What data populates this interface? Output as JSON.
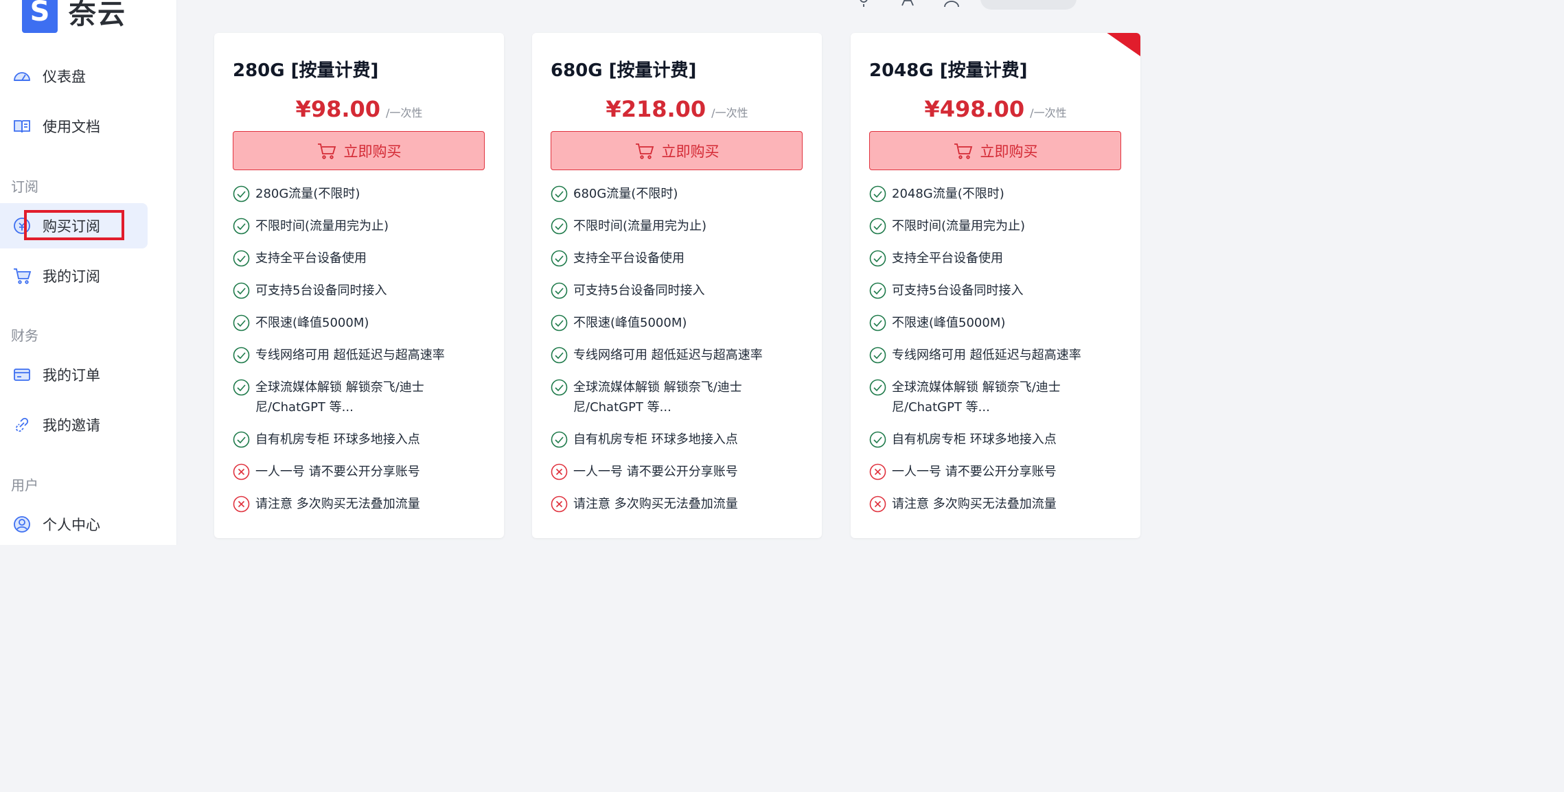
{
  "brand": {
    "logo_letter": "S",
    "name": "奈云",
    "color": "#3d6ff1"
  },
  "sidebar": {
    "items": [
      {
        "label": "仪表盘",
        "icon": "dashboard-icon"
      },
      {
        "label": "使用文档",
        "icon": "book-icon"
      },
      {
        "label": "购买订阅",
        "icon": "coin-icon",
        "active": true
      },
      {
        "label": "我的订阅",
        "icon": "cart-icon"
      },
      {
        "label": "我的订单",
        "icon": "wallet-icon"
      },
      {
        "label": "我的邀请",
        "icon": "link-icon"
      },
      {
        "label": "个人中心",
        "icon": "user-icon"
      }
    ],
    "sections": {
      "subscribe": "订阅",
      "finance": "财务",
      "user": "用户"
    }
  },
  "topbar": {
    "icons": [
      "sun-icon",
      "translate-icon",
      "user-menu-icon",
      "search-icon"
    ]
  },
  "buy_label": "立即购买",
  "plans": [
    {
      "title": "280G [按量计费]",
      "price": "¥98.00",
      "period": "/一次性",
      "features": [
        {
          "text": "280G流量(不限时)",
          "ok": true
        },
        {
          "text": "不限时间(流量用完为止)",
          "ok": true
        },
        {
          "text": "支持全平台设备使用",
          "ok": true
        },
        {
          "text": "可支持5台设备同时接入",
          "ok": true
        },
        {
          "text": "不限速(峰值5000M)",
          "ok": true
        },
        {
          "text": "专线网络可用 超低延迟与超高速率",
          "ok": true
        },
        {
          "text": "全球流媒体解锁 解锁奈飞/迪士尼/ChatGPT 等...",
          "ok": true
        },
        {
          "text": "自有机房专柜 环球多地接入点",
          "ok": true
        },
        {
          "text": "一人一号 请不要公开分享账号",
          "ok": false
        },
        {
          "text": "请注意 多次购买无法叠加流量",
          "ok": false
        }
      ]
    },
    {
      "title": "680G [按量计费]",
      "price": "¥218.00",
      "period": "/一次性",
      "features": [
        {
          "text": "680G流量(不限时)",
          "ok": true
        },
        {
          "text": "不限时间(流量用完为止)",
          "ok": true
        },
        {
          "text": "支持全平台设备使用",
          "ok": true
        },
        {
          "text": "可支持5台设备同时接入",
          "ok": true
        },
        {
          "text": "不限速(峰值5000M)",
          "ok": true
        },
        {
          "text": "专线网络可用 超低延迟与超高速率",
          "ok": true
        },
        {
          "text": "全球流媒体解锁 解锁奈飞/迪士尼/ChatGPT 等...",
          "ok": true
        },
        {
          "text": "自有机房专柜 环球多地接入点",
          "ok": true
        },
        {
          "text": "一人一号 请不要公开分享账号",
          "ok": false
        },
        {
          "text": "请注意 多次购买无法叠加流量",
          "ok": false
        }
      ]
    },
    {
      "title": "2048G [按量计费]",
      "price": "¥498.00",
      "period": "/一次性",
      "features": [
        {
          "text": "2048G流量(不限时)",
          "ok": true
        },
        {
          "text": "不限时间(流量用完为止)",
          "ok": true
        },
        {
          "text": "支持全平台设备使用",
          "ok": true
        },
        {
          "text": "可支持5台设备同时接入",
          "ok": true
        },
        {
          "text": "不限速(峰值5000M)",
          "ok": true
        },
        {
          "text": "专线网络可用 超低延迟与超高速率",
          "ok": true
        },
        {
          "text": "全球流媒体解锁 解锁奈飞/迪士尼/ChatGPT 等...",
          "ok": true
        },
        {
          "text": "自有机房专柜 环球多地接入点",
          "ok": true
        },
        {
          "text": "一人一号 请不要公开分享账号",
          "ok": false
        },
        {
          "text": "请注意 多次购买无法叠加流量",
          "ok": false
        }
      ]
    }
  ],
  "colors": {
    "price": "#d42a35",
    "button_bg": "#fcb4b8",
    "check": "#1e7a4a",
    "cross": "#e0323e",
    "active_nav_bg": "#eaf0fd"
  }
}
